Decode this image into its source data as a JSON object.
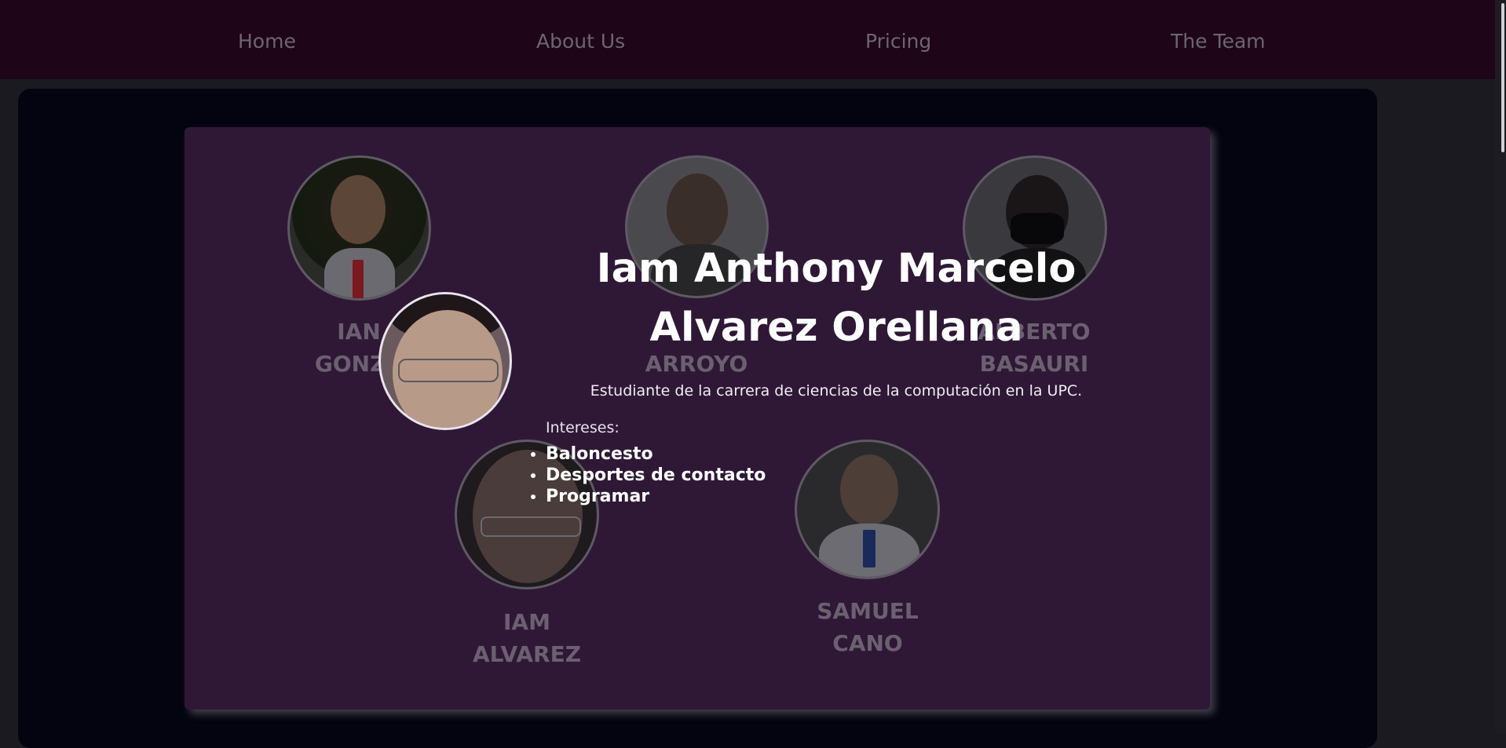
{
  "nav": {
    "items": [
      {
        "label": "Home"
      },
      {
        "label": "About Us"
      },
      {
        "label": "Pricing"
      },
      {
        "label": "The Team"
      }
    ]
  },
  "team": {
    "members": [
      {
        "line1": "IAN",
        "line2": "GONZÁ"
      },
      {
        "line1": "",
        "line2": "ARROYO"
      },
      {
        "line1": "ALBERTO",
        "line2": "BASAURI"
      },
      {
        "line1": "IAM",
        "line2": "ALVAREZ"
      },
      {
        "line1": "SAMUEL",
        "line2": "CANO"
      }
    ]
  },
  "detail": {
    "name_line1": "Iam Anthony Marcelo",
    "name_line2": "Alvarez Orellana",
    "description": "Estudiante de la carrera de ciencias de la computación en la UPC.",
    "interests_label": "Intereses:",
    "interests": [
      "Baloncesto",
      "Desportes de contacto",
      "Programar"
    ]
  },
  "colors": {
    "navbar_bg": "#1e0518",
    "card_bg": "#2f1836",
    "panel_bg": "#040410",
    "nav_text": "#6e6470",
    "muted_name": "#6b6070"
  }
}
